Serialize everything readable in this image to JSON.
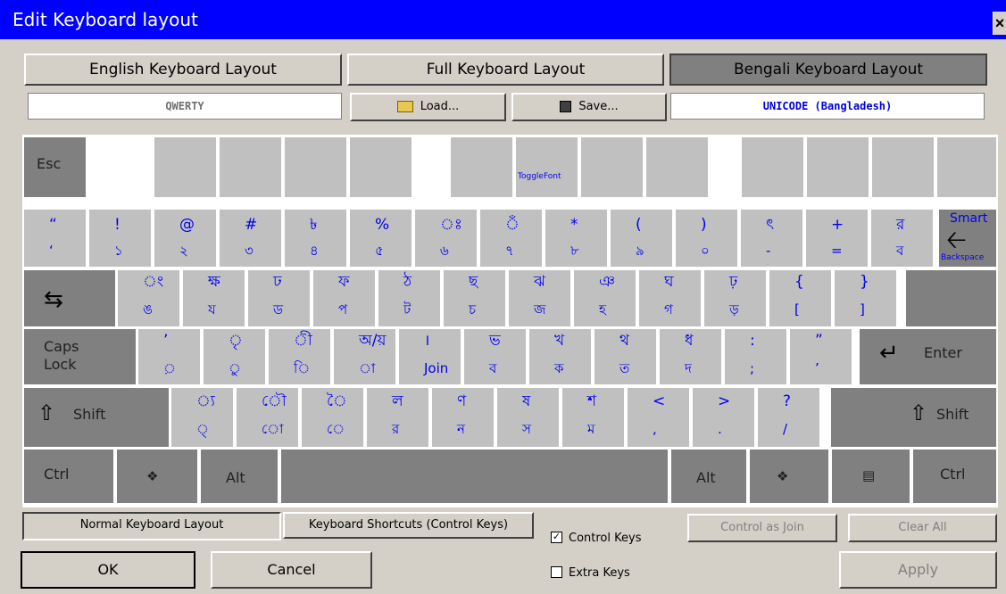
{
  "window": {
    "title": "Edit Keyboard layout",
    "close": "×"
  },
  "top_tabs": [
    "English Keyboard Layout",
    "Full Keyboard Layout",
    "Bengali Keyboard Layout"
  ],
  "fields": {
    "english": "QWERTY",
    "bengali": "UNICODE (Bangladesh)"
  },
  "buttons": {
    "load": "Load...",
    "save": "Save...",
    "control_as_join": "Control as Join",
    "clear_all": "Clear All",
    "ok": "OK",
    "cancel": "Cancel",
    "apply": "Apply"
  },
  "function_row": {
    "esc": "Esc",
    "toggle_font": "ToggleFont"
  },
  "number_row": [
    {
      "top": "“",
      "bottom": "‘"
    },
    {
      "top": "!",
      "bottom": "১"
    },
    {
      "top": "@",
      "bottom": "২"
    },
    {
      "top": "#",
      "bottom": "৩"
    },
    {
      "top": "৳",
      "bottom": "৪"
    },
    {
      "top": "%",
      "bottom": "৫"
    },
    {
      "top": "ঃ",
      "bottom": "৬"
    },
    {
      "top": "ঁ",
      "bottom": "৭"
    },
    {
      "top": "*",
      "bottom": "৮"
    },
    {
      "top": "(",
      "bottom": "৯"
    },
    {
      "top": ")",
      "bottom": "০"
    },
    {
      "top": "ৎ",
      "bottom": "-"
    },
    {
      "top": "+",
      "bottom": "="
    },
    {
      "top": "র",
      "bottom": "ব"
    }
  ],
  "backspace": {
    "top": "Smart",
    "bottom": "Backspace"
  },
  "tab_row": [
    {
      "top": "ং",
      "bottom": "ঙ"
    },
    {
      "top": "ক্ষ",
      "bottom": "য"
    },
    {
      "top": "ঢ",
      "bottom": "ড"
    },
    {
      "top": "ফ",
      "bottom": "প"
    },
    {
      "top": "ঠ",
      "bottom": "ট"
    },
    {
      "top": "ছ",
      "bottom": "চ"
    },
    {
      "top": "ঝ",
      "bottom": "জ"
    },
    {
      "top": "ঞ",
      "bottom": "হ"
    },
    {
      "top": "ঘ",
      "bottom": "গ"
    },
    {
      "top": "ঢ়",
      "bottom": "ড়"
    },
    {
      "top": "{",
      "bottom": "["
    },
    {
      "top": "}",
      "bottom": "]"
    }
  ],
  "caps_row": [
    {
      "top": "ʼ",
      "bottom": "়"
    },
    {
      "top": "ৃ",
      "bottom": "ু"
    },
    {
      "top": "ী",
      "bottom": "ি"
    },
    {
      "top": "অ/য়",
      "bottom": "া"
    },
    {
      "top": "।",
      "bottom": "Join"
    },
    {
      "top": "ভ",
      "bottom": "ব"
    },
    {
      "top": "খ",
      "bottom": "ক"
    },
    {
      "top": "থ",
      "bottom": "ত"
    },
    {
      "top": "ধ",
      "bottom": "দ"
    },
    {
      "top": ":",
      "bottom": ";"
    },
    {
      "top": "”",
      "bottom": "’"
    }
  ],
  "caps_label": [
    "Caps",
    "Lock"
  ],
  "enter_label": "Enter",
  "shift_row": [
    {
      "top": "্য",
      "bottom": "্"
    },
    {
      "top": "ৌ",
      "bottom": "ো"
    },
    {
      "top": "ৈ",
      "bottom": "ে"
    },
    {
      "top": "ল",
      "bottom": "র"
    },
    {
      "top": "ণ",
      "bottom": "ন"
    },
    {
      "top": "ষ",
      "bottom": "স"
    },
    {
      "top": "শ",
      "bottom": "ম"
    },
    {
      "top": "<",
      "bottom": ","
    },
    {
      "top": ">",
      "bottom": "."
    },
    {
      "top": "?",
      "bottom": "/"
    }
  ],
  "shift_label": "Shift",
  "bottom_row": {
    "ctrl": "Ctrl",
    "alt": "Alt"
  },
  "bottom_tabs": [
    "Normal Keyboard Layout",
    "Keyboard Shortcuts (Control Keys)"
  ],
  "checkboxes": {
    "control_keys": "Control Keys",
    "extra_keys": "Extra Keys"
  },
  "colors": {
    "title_bar": "#0000ff",
    "key_glyph": "#0000ee",
    "key_light": "#c0c0c0",
    "key_dark": "#808080"
  }
}
